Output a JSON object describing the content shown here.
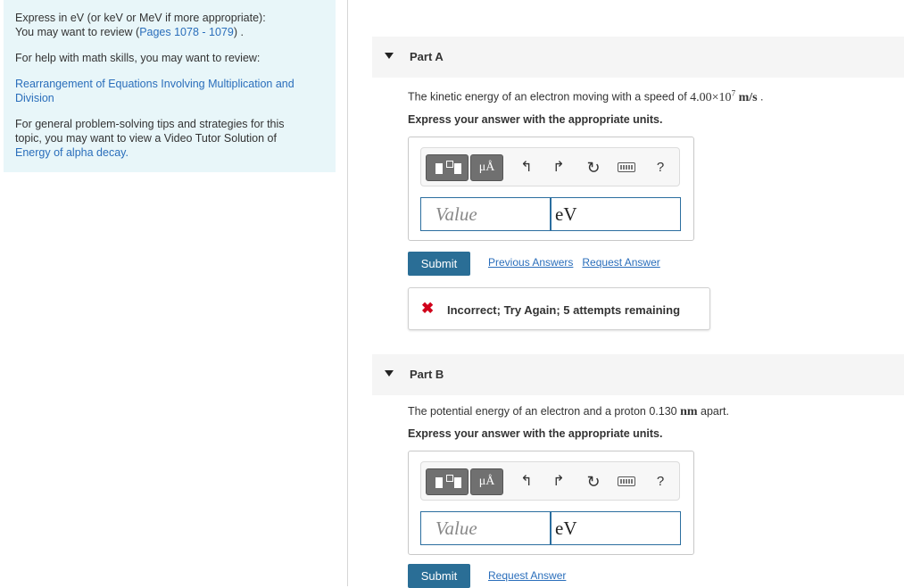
{
  "sidebar": {
    "line1": "Express in eV (or keV or MeV if more appropriate):",
    "line2_prefix": "You may want to review (",
    "line2_link": "Pages 1078 - 1079",
    "line2_suffix": ") .",
    "math_help": "For help with math skills, you may want to review:",
    "math_link_line1": "Rearrangement of Equations Involving Multiplication and",
    "math_link_line2": "Division",
    "tips_line1": "For general problem-solving tips and strategies for this",
    "tips_line2": "topic, you may want to view a Video Tutor Solution of",
    "tips_link": "Energy of alpha decay."
  },
  "partA": {
    "title": "Part A",
    "question_prefix": "The kinetic energy of an electron moving with a speed of ",
    "question_value": "4.00×10",
    "question_exp": "7",
    "question_unit": "m/s",
    "question_suffix": " .",
    "instruction": "Express your answer with the appropriate units.",
    "mu_label": "μÅ",
    "help_label": "?",
    "value_placeholder": "Value",
    "unit_value": "eV",
    "submit_label": "Submit",
    "prev_answers_label": "Previous Answers",
    "request_answer_label": "Request Answer",
    "feedback_icon": "✖",
    "feedback_text": "Incorrect; Try Again; 5 attempts remaining"
  },
  "partB": {
    "title": "Part B",
    "question_prefix": "The potential energy of an electron and a proton 0.130 ",
    "question_unit": "nm",
    "question_suffix": " apart.",
    "instruction": "Express your answer with the appropriate units.",
    "mu_label": "μÅ",
    "help_label": "?",
    "value_placeholder": "Value",
    "unit_value": "eV",
    "submit_label": "Submit",
    "request_answer_label": "Request Answer"
  },
  "icons": {
    "undo": "↰",
    "redo": "↱",
    "reset": "↻"
  }
}
